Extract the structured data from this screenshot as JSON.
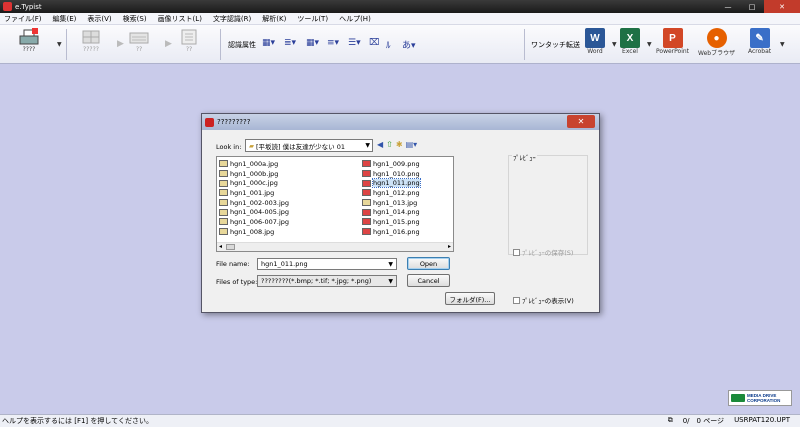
{
  "window": {
    "title": "e.Typist",
    "min": "—",
    "max": "□",
    "close": "✕"
  },
  "menu": [
    "ファイル(F)",
    "編集(E)",
    "表示(V)",
    "検索(S)",
    "画像リスト(L)",
    "文字認識(R)",
    "解析(K)",
    "ツール(T)",
    "ヘルプ(H)"
  ],
  "toolbar": {
    "btn1_label": "????",
    "btn2_label": "?????",
    "btn3_label": "??",
    "btn4_label": "??",
    "attr_label": "認識属性",
    "send_label": "ワンタッチ転送",
    "apps": [
      {
        "label": "Word",
        "icon": "word-icon",
        "letter": "W",
        "color": "#2b5797"
      },
      {
        "label": "Excel",
        "icon": "excel-icon",
        "letter": "X",
        "color": "#1e7145"
      },
      {
        "label": "PowerPoint",
        "icon": "powerpoint-icon",
        "letter": "P",
        "color": "#d24726"
      },
      {
        "label": "Webブラウザ",
        "icon": "firefox-icon",
        "letter": "●",
        "color": "#e66000"
      },
      {
        "label": "Acrobat",
        "icon": "acrobat-icon",
        "letter": "✎",
        "color": "#3a6fc8"
      }
    ]
  },
  "dialog": {
    "title": "?????????",
    "close": "✕",
    "lookin_label": "Look in:",
    "lookin_value": "[平坂読] 僕は友達が少ない 01",
    "preview_title": "ﾌﾟﾚﾋﾞｭｰ",
    "files_col1": [
      {
        "name": "hgn1_000a.jpg",
        "type": "jpg"
      },
      {
        "name": "hgn1_000b.jpg",
        "type": "jpg"
      },
      {
        "name": "hgn1_000c.jpg",
        "type": "jpg"
      },
      {
        "name": "hgn1_001.jpg",
        "type": "jpg"
      },
      {
        "name": "hgn1_002-003.jpg",
        "type": "jpg"
      },
      {
        "name": "hgn1_004-005.jpg",
        "type": "jpg"
      },
      {
        "name": "hgn1_006-007.jpg",
        "type": "jpg"
      },
      {
        "name": "hgn1_008.jpg",
        "type": "jpg"
      }
    ],
    "files_col2": [
      {
        "name": "hgn1_009.png",
        "type": "png"
      },
      {
        "name": "hgn1_010.png",
        "type": "png"
      },
      {
        "name": "hgn1_011.png",
        "type": "png",
        "selected": true
      },
      {
        "name": "hgn1_012.png",
        "type": "png"
      },
      {
        "name": "hgn1_013.jpg",
        "type": "jpg"
      },
      {
        "name": "hgn1_014.png",
        "type": "png"
      },
      {
        "name": "hgn1_015.png",
        "type": "png"
      },
      {
        "name": "hgn1_016.png",
        "type": "png"
      }
    ],
    "filename_label": "File name:",
    "filename_value": "hgn1_011.png",
    "filetype_label": "Files of type:",
    "filetype_value": "????????(*.bmp; *.tif; *.jpg; *.png)",
    "open_label": "Open",
    "cancel_label": "Cancel",
    "folder_label": "フォルダ(F)...",
    "save_preview_label": "ﾌﾟﾚﾋﾞｭｰの保存(S)",
    "show_preview_label": "ﾌﾟﾚﾋﾞｭｰの表示(V)"
  },
  "logo": {
    "line1": "MEDIA DRIVE",
    "line2": "CORPORATION"
  },
  "status": {
    "help": "ヘルプを表示するには [F1] を押してください。",
    "page": "0/　0 ページ",
    "file": "USRPAT120.UPT"
  }
}
